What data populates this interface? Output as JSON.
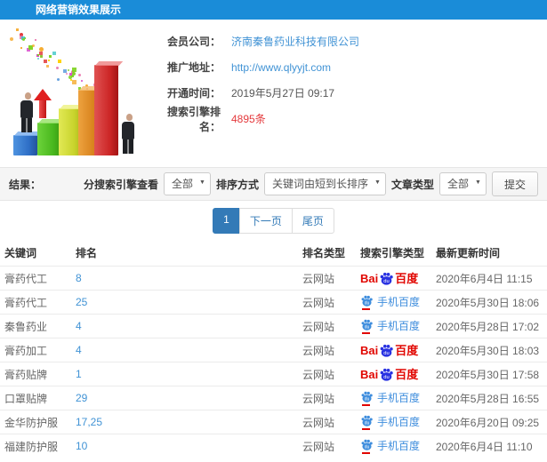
{
  "header": {
    "title": "网络营销效果展示"
  },
  "info": {
    "fields": [
      {
        "label": "会员公司：",
        "value": "济南秦鲁药业科技有限公司",
        "style": "link"
      },
      {
        "label": "推广地址：",
        "value": "http://www.qlyyjt.com",
        "style": "link"
      },
      {
        "label": "开通时间：",
        "value": "2019年5月27日 09:17",
        "style": "text"
      },
      {
        "label": "搜索引擎排名：",
        "value": "4895条",
        "style": "hl"
      }
    ]
  },
  "filters": {
    "result_label": "结果：",
    "engine_label": "分搜索引擎查看",
    "engine_value": "全部",
    "sort_label": "排序方式",
    "sort_value": "关键词由短到长排序",
    "article_label": "文章类型",
    "article_value": "全部",
    "submit_label": "提交"
  },
  "pagination": {
    "current": "1",
    "next_label": "下一页",
    "last_label": "尾页"
  },
  "engines": {
    "baidu": {
      "bai": "Bai",
      "du": "du",
      "cn": "百度"
    },
    "mobile": {
      "label": "手机百度"
    }
  },
  "table": {
    "headers": [
      "关键词",
      "排名",
      "排名类型",
      "搜索引擎类型",
      "最新更新时间"
    ],
    "rows": [
      {
        "keyword": "膏药代工",
        "rank": "8",
        "rank_type": "云网站",
        "engine": "baidu",
        "updated": "2020年6月4日 11:15"
      },
      {
        "keyword": "膏药代工",
        "rank": "25",
        "rank_type": "云网站",
        "engine": "mobile",
        "updated": "2020年5月30日 18:06"
      },
      {
        "keyword": "秦鲁药业",
        "rank": "4",
        "rank_type": "云网站",
        "engine": "mobile",
        "updated": "2020年5月28日 17:02"
      },
      {
        "keyword": "膏药加工",
        "rank": "4",
        "rank_type": "云网站",
        "engine": "baidu",
        "updated": "2020年5月30日 18:03"
      },
      {
        "keyword": "膏药贴牌",
        "rank": "1",
        "rank_type": "云网站",
        "engine": "baidu",
        "updated": "2020年5月30日 17:58"
      },
      {
        "keyword": "口罩贴牌",
        "rank": "29",
        "rank_type": "云网站",
        "engine": "mobile",
        "updated": "2020年5月28日 16:55"
      },
      {
        "keyword": "金华防护服",
        "rank": "17,25",
        "rank_type": "云网站",
        "engine": "mobile",
        "updated": "2020年6月20日 09:25"
      },
      {
        "keyword": "福建防护服",
        "rank": "10",
        "rank_type": "云网站",
        "engine": "mobile",
        "updated": "2020年6月4日 11:10"
      }
    ]
  },
  "colors": {
    "accent": "#1a8cd8",
    "link": "#4193d5",
    "highlight": "#e4393c",
    "baidu-red": "#e10601",
    "baidu-blue": "#2932e1",
    "mobile-blue": "#3e8ddd",
    "page-active": "#337ab7"
  }
}
